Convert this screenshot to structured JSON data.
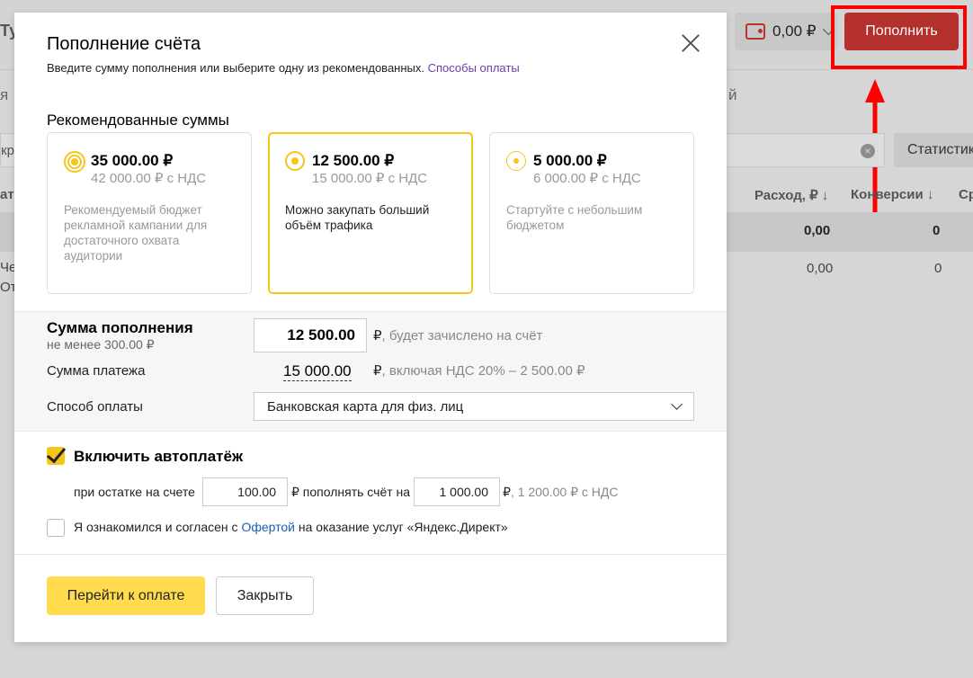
{
  "background": {
    "title_fragment": "Ту",
    "wallet_amount": "0,00 ₽",
    "topup_label": "Пополнить",
    "tab_fragment_left": "я",
    "tab_fragment_right": "й",
    "search_fragment": "кр",
    "stat_button": "Статистик",
    "columns": {
      "left": "ат",
      "spend": "Расход, ₽ ↓",
      "conversions": "Конверсии ↓",
      "extra": "Ср"
    },
    "total_row": {
      "spend": "0,00",
      "conversions": "0"
    },
    "data_row": {
      "name_fragment": "Че",
      "sub_fragment": "От",
      "spend": "0,00",
      "conversions": "0"
    },
    "highlight_color": "#ff0000"
  },
  "modal": {
    "title": "Пополнение счёта",
    "subtitle": "Введите сумму пополнения или выберите одну из рекомендованных.",
    "payment_methods_link": "Способы оплаты",
    "recommended_title": "Рекомендованные суммы",
    "cards": [
      {
        "amount": "35 000.00 ₽",
        "vat": "42 000.00 ₽ с НДС",
        "desc": "Рекомендуемый бюджет рекламной кампании для достаточного охвата аудитории",
        "selected": false
      },
      {
        "amount": "12 500.00 ₽",
        "vat": "15 000.00 ₽ с НДС",
        "desc": "Можно закупать больший объём трафика",
        "selected": true
      },
      {
        "amount": "5 000.00 ₽",
        "vat": "6 000.00 ₽ с НДС",
        "desc": "Стартуйте с небольшим бюджетом",
        "selected": false
      }
    ],
    "sum": {
      "label": "Сумма пополнения",
      "min": "не менее 300.00 ₽",
      "value": "12 500.00",
      "currency": "₽",
      "note": ", будет зачислено на счёт"
    },
    "payment": {
      "label": "Сумма платежа",
      "value": "15 000.00",
      "currency": "₽",
      "note": ", включая НДС 20% – 2 500.00 ₽"
    },
    "method": {
      "label": "Способ оплаты",
      "selected": "Банковская карта для физ. лиц"
    },
    "autopay": {
      "label": "Включить автоплатёж",
      "checked": true,
      "when_balance_text": "при остатке на счете",
      "threshold": "100.00",
      "topup_text": "₽ пополнять счёт на",
      "amount": "1 000.00",
      "amount_suffix": "₽",
      "vat_note": ", 1 200.00 ₽ с НДС"
    },
    "agreement": {
      "prefix": "Я ознакомился и согласен с",
      "link": "Офертой",
      "suffix": "на оказание услуг «Яндекс.Директ»",
      "checked": false
    },
    "buttons": {
      "pay": "Перейти к оплате",
      "close": "Закрыть"
    },
    "accent_color": "#f5c518",
    "pay_button_color": "#ffdb4d"
  }
}
